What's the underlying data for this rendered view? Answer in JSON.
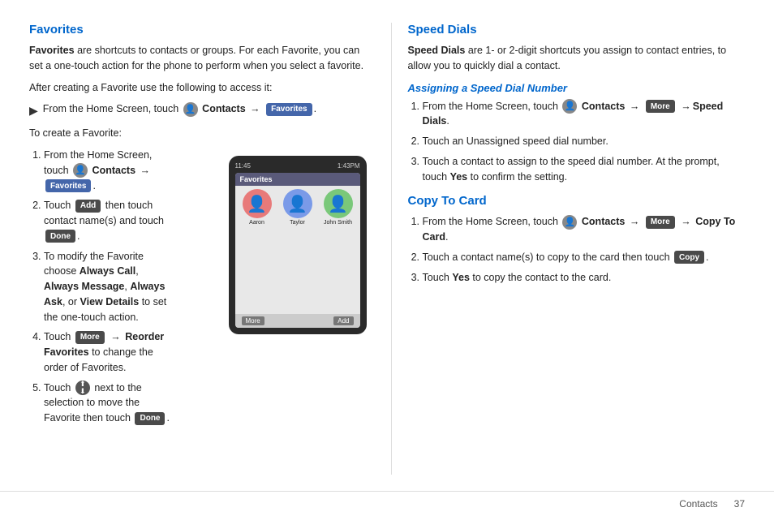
{
  "left": {
    "title": "Favorites",
    "intro": "Favorites are shortcuts to contacts or groups. For each Favorite, you can set a one-touch action for the phone to perform when you select a favorite.",
    "after_creating": "After creating a Favorite use the following to access it:",
    "bullet_access": "From the Home Screen, touch",
    "contacts_label": "Contacts",
    "arrow": "→",
    "favorites_btn": "Favorites",
    "to_create": "To create a Favorite:",
    "steps": [
      {
        "num": 1,
        "parts": [
          "From the Home Screen, touch",
          "Contacts",
          "→",
          "Favorites",
          "."
        ]
      },
      {
        "num": 2,
        "parts": [
          "Touch",
          "Add",
          "then touch contact name(s) and touch",
          "Done",
          "."
        ]
      },
      {
        "num": 3,
        "text": "To modify the Favorite choose Always Call, Always Message, Always Ask, or View Details to set the one-touch action."
      },
      {
        "num": 4,
        "parts": [
          "Touch",
          "More",
          "→ Reorder Favorites to change the order of Favorites."
        ]
      },
      {
        "num": 5,
        "parts": [
          "Touch",
          "↕",
          "next to the selection to move the Favorite then touch",
          "Done",
          "."
        ]
      }
    ],
    "phone": {
      "status_left": "11:45",
      "status_right": "1:43 PM",
      "header": "Favorites",
      "contacts": [
        {
          "name": "Aaron",
          "color": "pink"
        },
        {
          "name": "Taylor",
          "color": "blue"
        },
        {
          "name": "John Smith",
          "color": "green"
        }
      ],
      "btn_more": "More",
      "btn_add": "Add"
    }
  },
  "right": {
    "title": "Speed Dials",
    "intro": "Speed Dials are 1- or 2-digit shortcuts you assign to contact entries, to allow you to quickly dial a contact.",
    "assigning_title": "Assigning a Speed Dial Number",
    "assigning_steps": [
      {
        "num": 1,
        "parts": [
          "From the Home Screen, touch",
          "Contacts",
          "→",
          "More",
          "→Speed Dials",
          "."
        ]
      },
      {
        "num": 2,
        "text": "Touch an Unassigned speed dial number."
      },
      {
        "num": 3,
        "text": "Touch a contact to assign to the speed dial number. At the prompt, touch Yes to confirm the setting."
      }
    ],
    "copy_title": "Copy To Card",
    "copy_steps": [
      {
        "num": 1,
        "parts": [
          "From the Home Screen, touch",
          "Contacts",
          "→",
          "More",
          "→",
          "Copy To Card",
          "."
        ]
      },
      {
        "num": 2,
        "parts": [
          "Touch a contact name(s) to copy to the card then touch",
          "Copy",
          "."
        ]
      },
      {
        "num": 3,
        "text": "Touch Yes to copy the contact to the card."
      }
    ]
  },
  "footer": {
    "label": "Contacts",
    "page": "37"
  }
}
